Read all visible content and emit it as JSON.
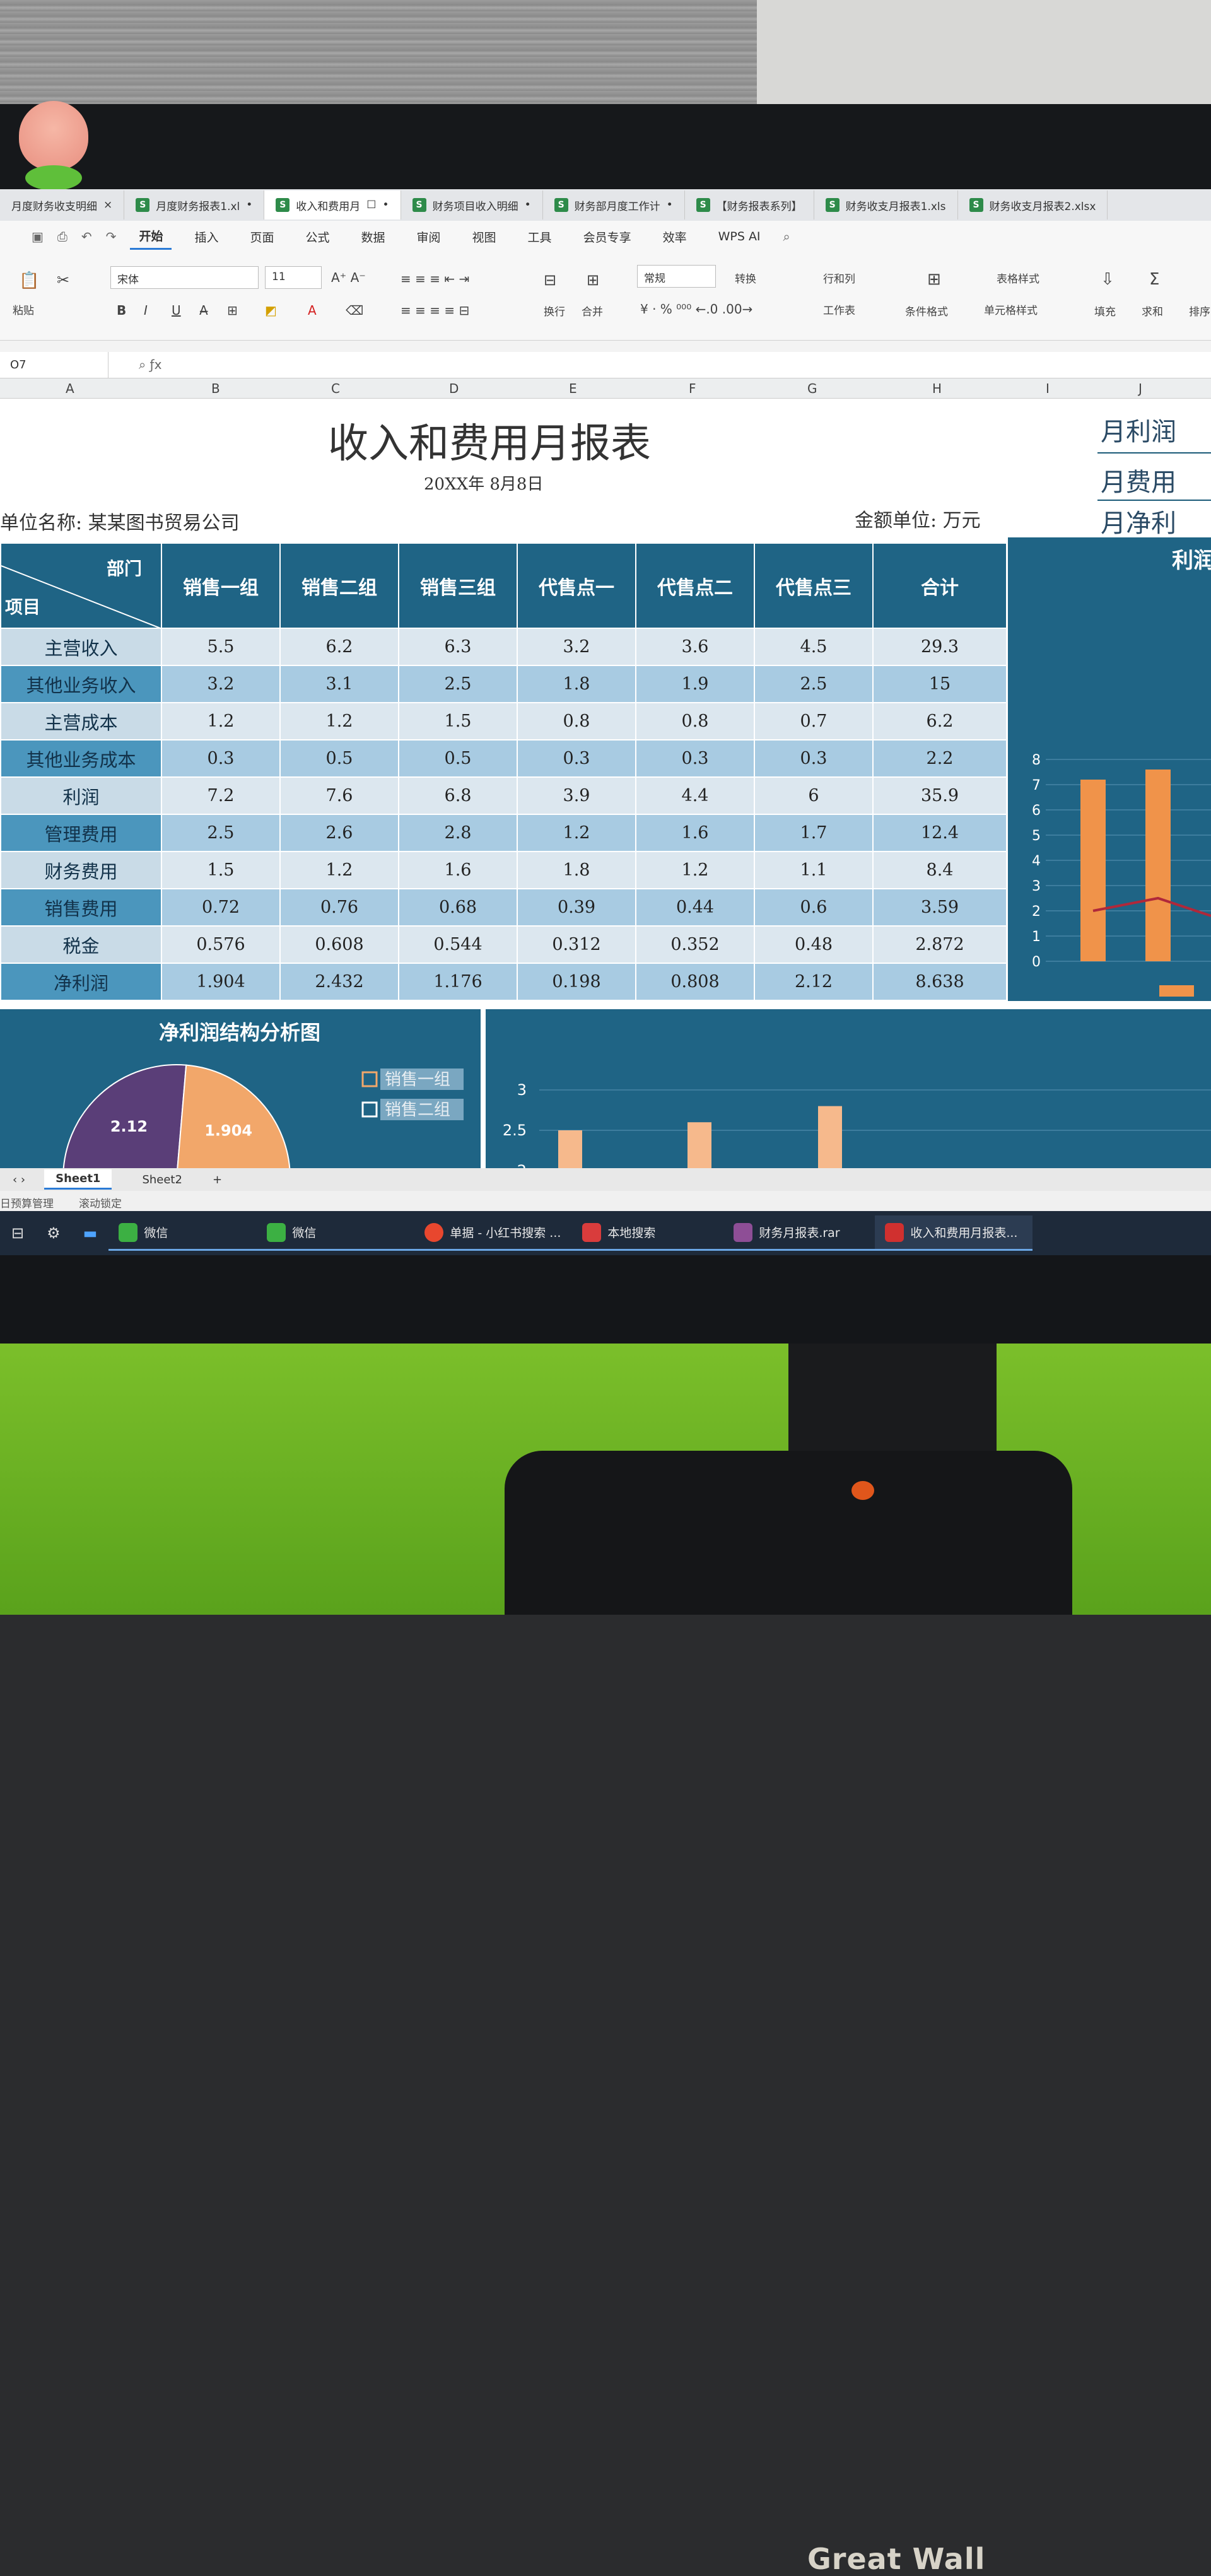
{
  "tabs": [
    {
      "label": "月度财务收支明细"
    },
    {
      "label": "月度财务报表1.xl"
    },
    {
      "label": "收入和费用月",
      "active": true
    },
    {
      "label": "财务项目收入明细"
    },
    {
      "label": "财务部月度工作计"
    },
    {
      "label": "【财务报表系列】"
    },
    {
      "label": "财务收支月报表1.xls"
    },
    {
      "label": "财务收支月报表2.xlsx"
    }
  ],
  "menus": [
    "开始",
    "插入",
    "页面",
    "公式",
    "数据",
    "审阅",
    "视图",
    "工具",
    "会员专享",
    "效率",
    "WPS AI"
  ],
  "ribbon": {
    "paste": "粘贴",
    "font_name": "宋体",
    "font_size": "11",
    "wrap": "换行",
    "merge": "合并",
    "number_format": "常规",
    "convert": "转换",
    "rows_cols": "行和列",
    "worksheet": "工作表",
    "cond_format": "条件格式",
    "table_style": "表格样式",
    "cell_style": "单元格样式",
    "fill": "填充",
    "sum": "求和",
    "sort": "排序"
  },
  "formula": {
    "cell_ref": "O7"
  },
  "columns": [
    "A",
    "B",
    "C",
    "D",
    "E",
    "F",
    "G",
    "H",
    "I",
    "J"
  ],
  "sheet": {
    "title": "收入和费用月报表",
    "date": "20XX年  8月8日",
    "unit_name": "单位名称:  某某图书贸易公司",
    "amount_unit": "金额单位: 万元",
    "summary": [
      "月利润",
      "月费用",
      "月净利"
    ]
  },
  "table": {
    "corner_dept": "部门",
    "corner_item": "项目",
    "headers": [
      "销售一组",
      "销售二组",
      "销售三组",
      "代售点一",
      "代售点二",
      "代售点三",
      "合计"
    ],
    "rows": [
      {
        "label": "主营收入",
        "values": [
          "5.5",
          "6.2",
          "6.3",
          "3.2",
          "3.6",
          "4.5",
          "29.3"
        ]
      },
      {
        "label": "其他业务收入",
        "values": [
          "3.2",
          "3.1",
          "2.5",
          "1.8",
          "1.9",
          "2.5",
          "15"
        ]
      },
      {
        "label": "主营成本",
        "values": [
          "1.2",
          "1.2",
          "1.5",
          "0.8",
          "0.8",
          "0.7",
          "6.2"
        ]
      },
      {
        "label": "其他业务成本",
        "values": [
          "0.3",
          "0.5",
          "0.5",
          "0.3",
          "0.3",
          "0.3",
          "2.2"
        ]
      },
      {
        "label": "利润",
        "values": [
          "7.2",
          "7.6",
          "6.8",
          "3.9",
          "4.4",
          "6",
          "35.9"
        ]
      },
      {
        "label": "管理费用",
        "values": [
          "2.5",
          "2.6",
          "2.8",
          "1.2",
          "1.6",
          "1.7",
          "12.4"
        ]
      },
      {
        "label": "财务费用",
        "values": [
          "1.5",
          "1.2",
          "1.6",
          "1.8",
          "1.2",
          "1.1",
          "8.4"
        ]
      },
      {
        "label": "销售费用",
        "values": [
          "0.72",
          "0.76",
          "0.68",
          "0.39",
          "0.44",
          "0.6",
          "3.59"
        ]
      },
      {
        "label": "税金",
        "values": [
          "0.576",
          "0.608",
          "0.544",
          "0.312",
          "0.352",
          "0.48",
          "2.872"
        ]
      },
      {
        "label": "净利润",
        "values": [
          "1.904",
          "2.432",
          "1.176",
          "0.198",
          "0.808",
          "2.12",
          "8.638"
        ]
      }
    ]
  },
  "chart_data": [
    {
      "type": "bar",
      "title": "利润",
      "ylim": [
        0,
        8
      ],
      "yticks": [
        "0",
        "1",
        "2",
        "3",
        "4",
        "5",
        "6",
        "7",
        "8"
      ],
      "values": [
        7.2,
        7.6
      ],
      "line_values": [
        2.0,
        2.5,
        1.8
      ],
      "bar_color": "#f0934a",
      "line_color": "#b0283a"
    },
    {
      "type": "pie",
      "title": "净利润结构分析图",
      "slices": [
        {
          "label": "2.12",
          "value": 2.12,
          "color": "#5a3e78"
        },
        {
          "label": "1.904",
          "value": 1.904,
          "color": "#f2a76a"
        }
      ],
      "legend": [
        "销售一组",
        "销售二组"
      ]
    },
    {
      "type": "bar",
      "yticks": [
        "2",
        "2.5",
        "3"
      ],
      "values": [
        2.5,
        2.6,
        2.8
      ],
      "bar_color": "#f6b98c"
    }
  ],
  "sheet_tabs": [
    "Sheet1",
    "Sheet2"
  ],
  "statusbar": [
    "日预算管理",
    "滚动锁定"
  ],
  "taskbar": [
    {
      "label": "微信",
      "color": "#3cb043"
    },
    {
      "label": "微信",
      "color": "#3cb043"
    },
    {
      "label": "单据 - 小红书搜索 ...",
      "color": "#e8472e"
    },
    {
      "label": "本地搜索",
      "color": "#d93c3c"
    },
    {
      "label": "财务月报表.rar",
      "color": "#8e4e96"
    },
    {
      "label": "收入和费用月报表...",
      "color": "#d0302f"
    }
  ],
  "brand": "Great Wall"
}
